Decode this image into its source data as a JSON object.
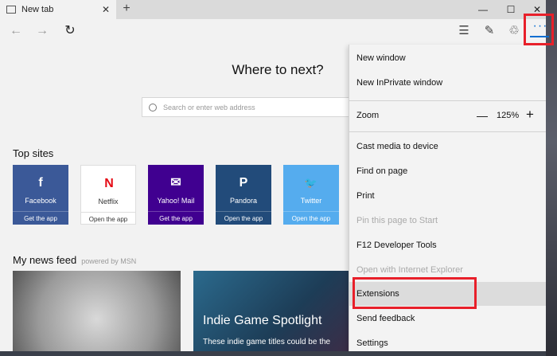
{
  "tab": {
    "title": "New tab"
  },
  "window_controls": {
    "minimize": "—",
    "maximize": "☐",
    "close": "✕"
  },
  "nav": {
    "back": "←",
    "forward": "→",
    "refresh": "↻"
  },
  "toolbar": {
    "hub": "☰",
    "note": "✎",
    "share": "♲",
    "more": "···"
  },
  "page": {
    "headline": "Where to next?",
    "search_placeholder": "Search or enter web address",
    "top_sites_title": "Top sites",
    "news_title": "My news feed",
    "news_powered": "powered by MSN",
    "tiles": [
      {
        "name": "Facebook",
        "action": "Get the app",
        "logo": "f",
        "color": "#3b5998"
      },
      {
        "name": "Netflix",
        "action": "Open the app",
        "logo": "N",
        "color": "#ffffff"
      },
      {
        "name": "Yahoo! Mail",
        "action": "Get the app",
        "logo": "✉",
        "color": "#400090"
      },
      {
        "name": "Pandora",
        "action": "Open the app",
        "logo": "P",
        "color": "#224b7a"
      },
      {
        "name": "Twitter",
        "action": "Open the app",
        "logo": "🐦",
        "color": "#55acee"
      }
    ],
    "news": [
      {
        "headline": "",
        "sub": ""
      },
      {
        "headline": "Indie Game Spotlight",
        "sub": "These indie game titles could be the"
      }
    ]
  },
  "menu": {
    "new_window": "New window",
    "new_inprivate": "New InPrivate window",
    "zoom_label": "Zoom",
    "zoom_minus": "—",
    "zoom_value": "125%",
    "zoom_plus": "+",
    "cast": "Cast media to device",
    "find": "Find on page",
    "print": "Print",
    "pin": "Pin this page to Start",
    "devtools": "F12 Developer Tools",
    "open_ie": "Open with Internet Explorer",
    "extensions": "Extensions",
    "feedback": "Send feedback",
    "settings": "Settings"
  },
  "colors": {
    "highlight_border": "#e8202a",
    "accent": "#0a6ed1"
  }
}
